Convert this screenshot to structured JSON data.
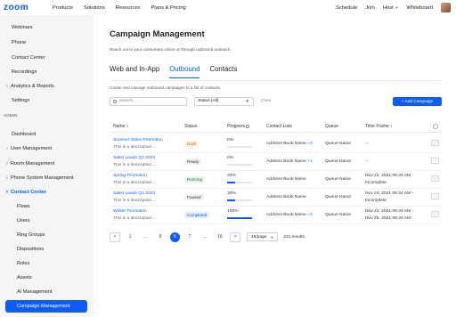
{
  "topnav": {
    "logo": "zoom",
    "items": [
      "Products",
      "Solutions",
      "Resources",
      "Plans & Pricing"
    ],
    "right": [
      "Schedule",
      "Join",
      "Host",
      "Whiteboard"
    ]
  },
  "sidebar": {
    "items": [
      {
        "label": "Webinars",
        "kind": "indent1"
      },
      {
        "label": "Phone",
        "kind": "indent1"
      },
      {
        "label": "Contact Center",
        "kind": "indent1"
      },
      {
        "label": "Recordings",
        "kind": "indent1"
      },
      {
        "label": "Analytics & Reports",
        "kind": "cat"
      },
      {
        "label": "Settings",
        "kind": "indent1"
      },
      {
        "label": "ADMIN",
        "kind": "label"
      },
      {
        "label": "Dashboard",
        "kind": "indent1"
      },
      {
        "label": "User Management",
        "kind": "cat"
      },
      {
        "label": "Room Management",
        "kind": "cat"
      },
      {
        "label": "Phone System Management",
        "kind": "cat"
      },
      {
        "label": "Contact Center",
        "kind": "catopen"
      },
      {
        "label": "Flows",
        "kind": "indent2"
      },
      {
        "label": "Users",
        "kind": "indent2"
      },
      {
        "label": "Ring Groups",
        "kind": "indent2"
      },
      {
        "label": "Dispositions",
        "kind": "indent2"
      },
      {
        "label": "Roles",
        "kind": "indent2"
      },
      {
        "label": "Assets",
        "kind": "indent2"
      },
      {
        "label": "AI Management",
        "kind": "indent2"
      },
      {
        "label": "Campaign Management",
        "kind": "active"
      },
      {
        "label": "Preferences",
        "kind": "indent2"
      }
    ]
  },
  "page": {
    "title": "Campaign Management",
    "subtitle": "Reach out to your consumers online or through outbound outreach.",
    "tabs": [
      "Web and In-App",
      "Outbound",
      "Contacts"
    ],
    "active_tab": "Outbound",
    "description": "Create and manage outbound campaigns to a list of contacts.",
    "search_placeholder": "Search...",
    "status_select": "Status (All)",
    "clear_label": "Clear",
    "add_button": "+ Add Campaign"
  },
  "table": {
    "headers": [
      "Name",
      "Status",
      "Progress",
      "Contact Lists",
      "Queue",
      "Time Frame"
    ],
    "rows": [
      {
        "name": "Summer Sales Promotion",
        "desc": "This is a description....",
        "status": "Draft",
        "status_class": "b-draft",
        "progress": 0,
        "progress_text": "0%",
        "contact": "Address Book Name",
        "contact_extra": "+2",
        "queue": "Queue Name",
        "time1": "--",
        "time2": ""
      },
      {
        "name": "Sales Leads Q2 2023",
        "desc": "This is a description....",
        "status": "Ready",
        "status_class": "b-ready",
        "progress": 0,
        "progress_text": "0%",
        "contact": "Address Book Name",
        "contact_extra": "+1",
        "queue": "Queue Name",
        "time1": "--",
        "time2": ""
      },
      {
        "name": "Spring Promotion",
        "desc": "This is a description....",
        "status": "Running",
        "status_class": "b-running",
        "progress": 33,
        "progress_text": "33%",
        "contact": "Address Book Name",
        "contact_extra": "",
        "queue": "Queue Name",
        "time1": "Nov 24, 2021 06:34 AM -",
        "time2": "Incomplete"
      },
      {
        "name": "Sales Leads Q1 2023",
        "desc": "This is a description....",
        "status": "Paused",
        "status_class": "b-paused",
        "progress": 33,
        "progress_text": "33%",
        "contact": "Address Book Name",
        "contact_extra": "",
        "queue": "Queue Name",
        "time1": "Nov 24, 2021 06:34 AM -",
        "time2": "Incomplete"
      },
      {
        "name": "Winter Promotion",
        "desc": "This is a description....",
        "status": "Completed",
        "status_class": "b-completed",
        "progress": 100,
        "progress_text": "100%",
        "contact": "Address Book Name",
        "contact_extra": "+2",
        "queue": "Queue Name",
        "time1": "Nov 24, 2021 06:34 AM -",
        "time2": "Nov 25, 2021 06:34 AM"
      }
    ]
  },
  "pagination": {
    "prev": "<",
    "pages": [
      "1",
      "...",
      "5",
      "6",
      "7",
      "...",
      "16"
    ],
    "active_page": "6",
    "next": ">",
    "per_page": "15/page",
    "results": "221 results"
  },
  "colors": {
    "accent": "#0b5cff",
    "sidebar_bg": "#f4f5f7"
  }
}
